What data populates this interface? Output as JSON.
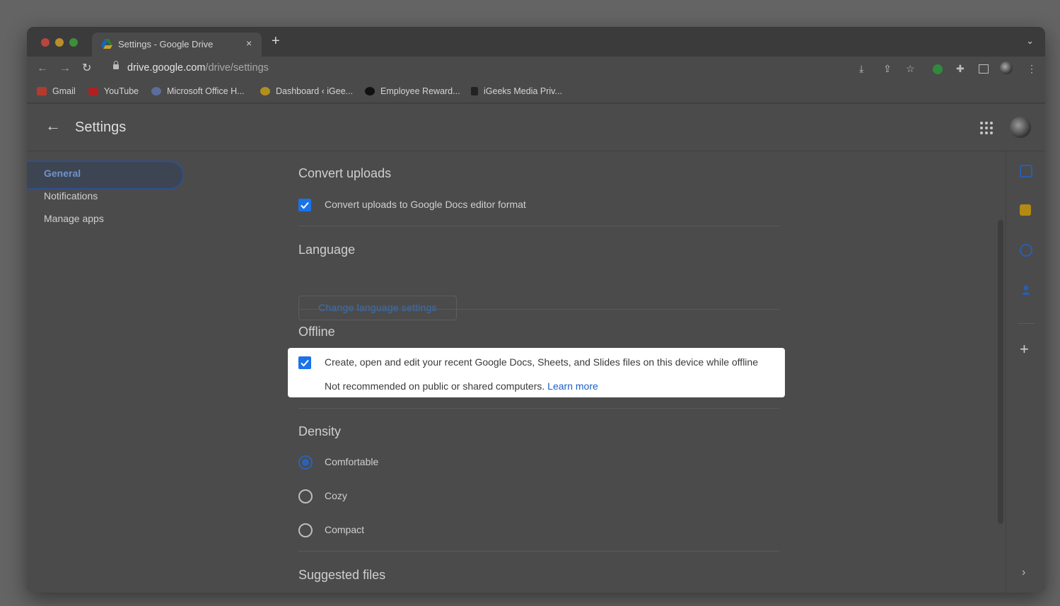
{
  "browser": {
    "tab_title": "Settings - Google Drive",
    "tab_close": "×",
    "new_tab": "+",
    "tab_list": "⌄",
    "url_domain": "drive.google.com",
    "url_path": "/drive/settings",
    "bookmarks": [
      "Gmail",
      "YouTube",
      "Microsoft Office H...",
      "Dashboard ‹ iGee...",
      "Employee Reward...",
      "iGeeks Media Priv..."
    ]
  },
  "header": {
    "title": "Settings"
  },
  "sidebar": {
    "items": [
      {
        "label": "General"
      },
      {
        "label": "Notifications"
      },
      {
        "label": "Manage apps"
      }
    ]
  },
  "sections": {
    "convert": {
      "title": "Convert uploads",
      "checkbox_label": "Convert uploads to Google Docs editor format",
      "checked": true
    },
    "language": {
      "title": "Language",
      "button_label": "Change language settings"
    },
    "offline": {
      "title": "Offline",
      "checkbox_label": "Create, open and edit your recent Google Docs, Sheets, and Slides files on this device while offline",
      "note": "Not recommended on public or shared computers.",
      "link": "Learn more",
      "checked": true
    },
    "density": {
      "title": "Density",
      "options": [
        "Comfortable",
        "Cozy",
        "Compact"
      ],
      "selected": "Comfortable"
    },
    "suggested": {
      "title": "Suggested files"
    }
  },
  "colors": {
    "accent": "#1a73e8",
    "link": "#1a5fc7",
    "highlight_bg": "#ffffff"
  }
}
